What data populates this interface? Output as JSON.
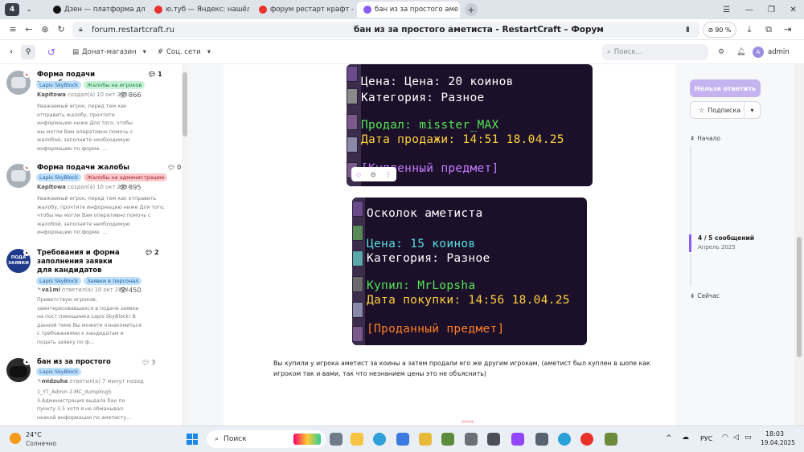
{
  "browser": {
    "workspace_badge": "4",
    "tabs": [
      {
        "label": "Дзен — платформа для п",
        "color": "#111111"
      },
      {
        "label": "ю.туб — Яндекс: нашёлся",
        "color": "#e8322a"
      },
      {
        "label": "форум рестарт крафт — Я",
        "color": "#e8322a"
      },
      {
        "label": "бан из за простого аме",
        "color": "#8a5cf6"
      }
    ],
    "url": "forum.restartcraft.ru",
    "page_title": "бан из за простого аметиста - RestartCraft – Форум",
    "zoom": "90 %"
  },
  "site_nav": {
    "donate": "Донат-магазин",
    "social": "Соц. сети",
    "search_placeholder": "Поиск...",
    "user": "admin",
    "user_initial": "A"
  },
  "sidebar": {
    "items": [
      {
        "title": "Форма подачи жалобы",
        "tags": [
          {
            "label": "Lapis SkyBlock",
            "bg": "#bfe0fb",
            "fg": "#1a5a9a"
          },
          {
            "label": "Жалобы на игроков",
            "bg": "#c6f3d7",
            "fg": "#1d7a44"
          }
        ],
        "author": "Kapitowa",
        "meta": "создал(а) 10 окт 2024",
        "views": "366",
        "replies": "1",
        "excerpt": "Уважаемый игрок, перед тем как отправить жалобу, прочтите информацию ниже Для того, чтобы мы могли Вам оперативно помочь с жалобой, заполните необходимую информацию по форме. ..."
      },
      {
        "title": "Форма подачи жалобы",
        "tags": [
          {
            "label": "Lapis SkyBlock",
            "bg": "#bfe0fb",
            "fg": "#1a5a9a"
          },
          {
            "label": "Жалобы на администрацию",
            "bg": "#fbc8cc",
            "fg": "#a3202b"
          }
        ],
        "author": "Kapitowa",
        "meta": "создал(а) 10 окт 2024",
        "views": "395",
        "replies": "0",
        "excerpt": "Уважаемый игрок, перед тем как отправить жалобу, прочтите информацию ниже Для того, чтобы мы могли Вам оперативно помочь с жалобой, заполните необходимую информацию по форме. ..."
      },
      {
        "title": "Требования и форма заполнения заявки для кандидатов",
        "tags": [
          {
            "label": "Lapis SkyBlock",
            "bg": "#bfe0fb",
            "fg": "#1a5a9a"
          },
          {
            "label": "Заявки в персонал",
            "bg": "#bfe0fb",
            "fg": "#1a5a9a"
          }
        ],
        "author": "va1mi",
        "meta": "ответил(а) 10 окт 2024",
        "views": "450",
        "replies": "2",
        "avatar_text": "ПОДА ЗАЯВКИ",
        "excerpt": "Приветствую игроков, заинтересовавшихся в подаче заявки на пост помощника Lapis SkyBlock! В данной теме Вы можете ознакомиться с требованиями к кандидатам и подать заявку по ф..."
      },
      {
        "title": "бан из за простого аметиста",
        "tags": [
          {
            "label": "Lapis SkyBlock",
            "bg": "#bfe0fb",
            "fg": "#1a5a9a"
          }
        ],
        "author": "midzuha",
        "meta": "ответил(а) 7 минут назад",
        "views": "",
        "replies": "3",
        "excerpt": "1_YT_Admin 2.MC_dumpling5 3.Администрация выдала бан по пункту 3.5 хотя я не обманывал нкакой информации по аметисту..."
      }
    ]
  },
  "post": {
    "screenshot1": {
      "price": "Цена: 20 коинов",
      "category": "Категория: Разное",
      "seller": "Продал: misster_MAX",
      "date": "Дата продажи: 14:51 18.04.25",
      "footer": "[Купленный предмет]"
    },
    "screenshot2": {
      "name": "Осколок аметиста",
      "price": "Цена: 15 коинов",
      "category": "Категория: Разное",
      "buyer": "Купил: MrLopsha",
      "date": "Дата покупки: 14:56 18.04.25",
      "footer": "[Проданный предмет]"
    },
    "text": "Вы купили у игрока аметист за коины а затем продали его же другим игрокам, (аметист был куплен в шопе как игроком так и вами, так что незнанием цены это не объяснить)",
    "more": "more"
  },
  "right_panel": {
    "reply_button": "Нельзя ответить",
    "subscribe_button": "Подписка",
    "start": "Начало",
    "progress": "4 / 5 сообщений",
    "date": "Апрель 2025",
    "now": "Сейчас"
  },
  "taskbar": {
    "temp": "24°C",
    "weather": "Солнечно",
    "search": "Поиск",
    "lang": "РУС",
    "time": "18:03",
    "date": "19.04.2025"
  },
  "colors": {
    "accent": "#8a5cf6",
    "mc_bg": "#1b0f2a",
    "mc_cyan": "#55dfdf",
    "mc_green": "#55e655",
    "mc_yellow": "#ffd23c",
    "mc_orange": "#ff7f27"
  }
}
